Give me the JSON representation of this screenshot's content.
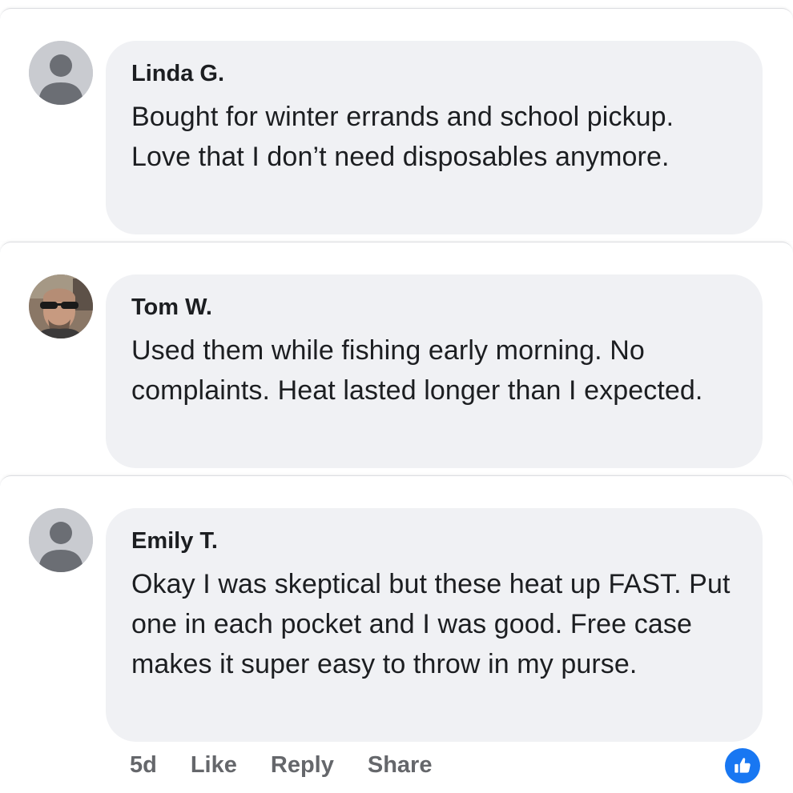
{
  "comments": [
    {
      "author": "Linda G.",
      "text": "Bought for winter errands and school pickup. Love that I don’t need disposables anymore.",
      "avatar": "default-avatar-icon"
    },
    {
      "author": "Tom W.",
      "text": "Used them while fishing early morning. No complaints. Heat lasted longer than I expected.",
      "avatar": "profile-photo"
    },
    {
      "author": "Emily T.",
      "text": "Okay I was skeptical but these heat up FAST. Put one in each pocket and I was good. Free case makes it super easy to throw in my purse.",
      "avatar": "default-avatar-icon"
    }
  ],
  "actions": {
    "time": "5d",
    "like": "Like",
    "reply": "Reply",
    "share": "Share"
  },
  "colors": {
    "bubble": "#f0f1f4",
    "action_text": "#65676b",
    "like_badge": "#1877f2"
  }
}
